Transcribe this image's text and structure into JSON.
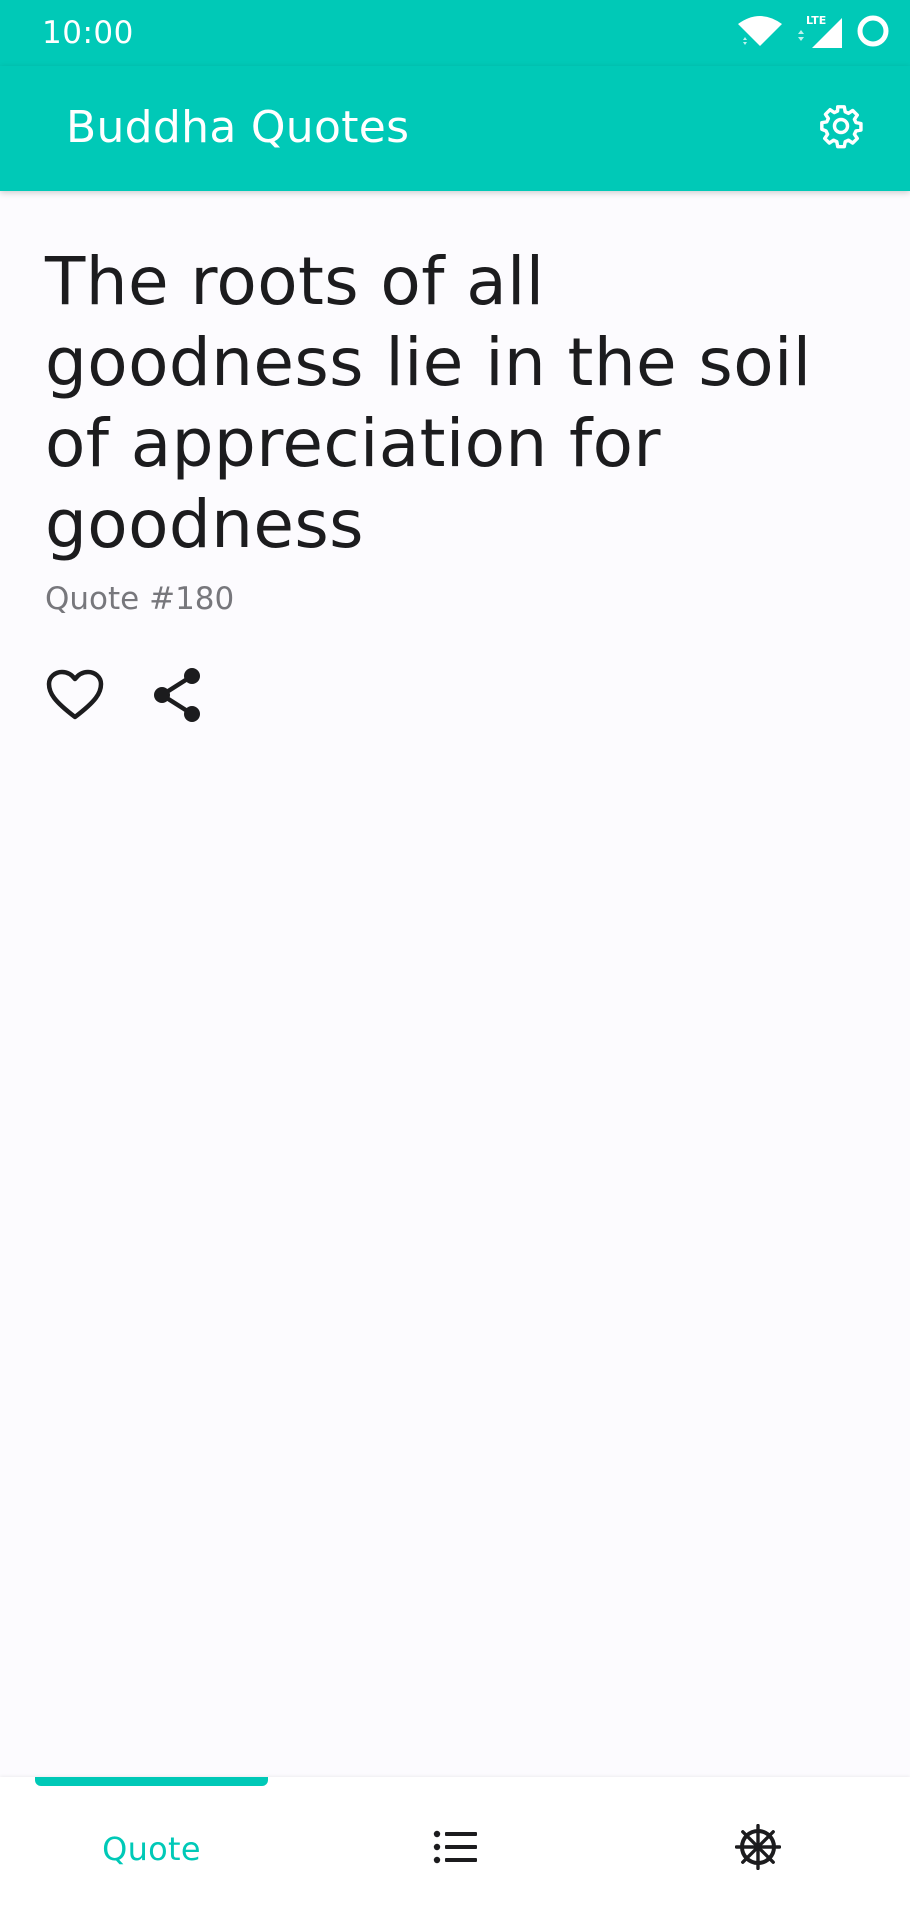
{
  "status_bar": {
    "time": "10:00",
    "network_label": "LTE",
    "icons": [
      "wifi-icon",
      "cellular-signal-icon",
      "battery-ring-icon"
    ]
  },
  "app_bar": {
    "title": "Buddha Quotes",
    "settings_icon": "gear-icon"
  },
  "quote": {
    "text": "The roots of all goodness lie in the soil of appreciation for goodness",
    "number": "Quote #180"
  },
  "actions": [
    {
      "name": "favorite",
      "icon": "heart-outline-icon"
    },
    {
      "name": "share",
      "icon": "share-icon"
    }
  ],
  "bottom_nav": {
    "items": [
      {
        "label": "Quote",
        "active": true
      },
      {
        "icon": "list-icon",
        "active": false
      },
      {
        "icon": "dharma-wheel-icon",
        "active": false
      }
    ]
  },
  "colors": {
    "accent": "#00c9b7",
    "background": "#fcfbfe",
    "text_primary": "#1c1c1e",
    "text_secondary": "#77777c"
  }
}
